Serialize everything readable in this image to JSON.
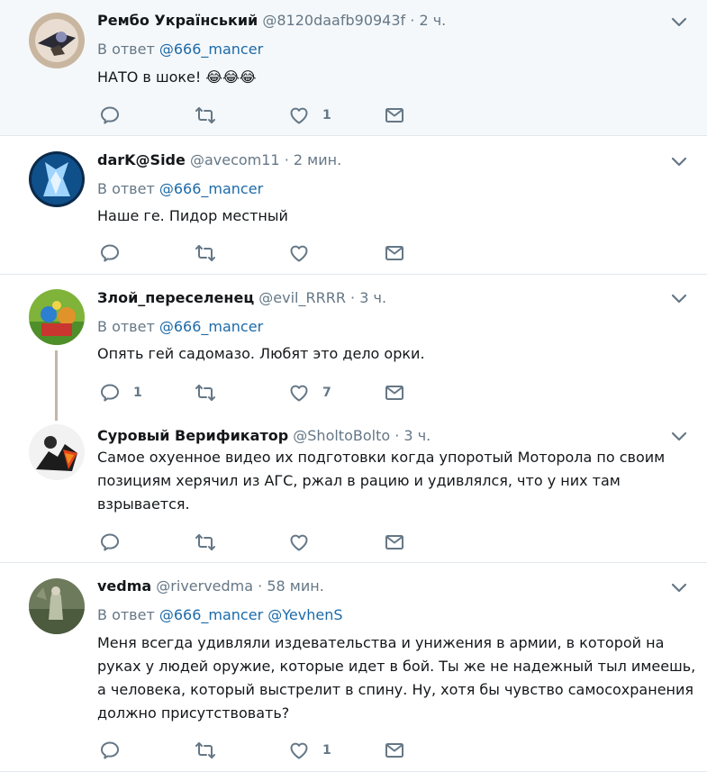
{
  "tweets": [
    {
      "name": "Рембо Український",
      "handle": "@8120daafb90943f",
      "time": "2 ч.",
      "reply_prefix": "В ответ",
      "reply_to": "@666_mancer",
      "text": "НАТО в шоке! 😂😂😂",
      "likes": "1"
    },
    {
      "name": "darK@Side",
      "handle": "@avecom11",
      "time": "2 мин.",
      "reply_prefix": "В ответ",
      "reply_to": "@666_mancer",
      "text": "Наше ге. Пидор местный"
    },
    {
      "name": "Злой_переселенец",
      "handle": "@evil_RRRR",
      "time": "3 ч.",
      "reply_prefix": "В ответ",
      "reply_to": "@666_mancer",
      "text": "Опять гей садомазо. Любят это дело орки.",
      "replies": "1",
      "likes": "7"
    },
    {
      "name": "Суровый Верификатор",
      "handle": "@SholtoBolto",
      "time": "3 ч.",
      "text_lines": [
        "Самое охуенное видео их подготовки когда упоротый Моторола по своим",
        "позициям херячил из АГС, ржал в рацию и удивлялся, что у них там",
        "взрывается."
      ]
    },
    {
      "name": "vedma",
      "handle": "@rivervedma",
      "time": "58 мин.",
      "reply_prefix": "В ответ",
      "reply_to": "@666_mancer",
      "reply_to2": "@YevhenS",
      "text_lines": [
        "Меня всегда удивляли издевательства и унижения в армии, в которой на",
        "руках у людей оружие, которые идет в бой. Ты же не надежный тыл имеешь,",
        "а человека, который выстрелит в спину. Ну, хотя бы чувство самосохранения",
        "должно присутствовать?"
      ],
      "likes": "1"
    }
  ],
  "separator": "·",
  "colors": {
    "text": "#14171a",
    "muted": "#657786",
    "link": "#1c6aa8",
    "highlight_bg": "#f5f8fa"
  },
  "icons": [
    "reply-icon",
    "retweet-icon",
    "like-icon",
    "dm-icon",
    "chevron-down-icon"
  ]
}
